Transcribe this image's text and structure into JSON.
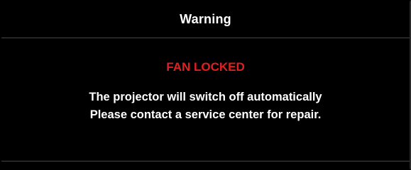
{
  "dialog": {
    "title": "Warning",
    "headline": "FAN LOCKED",
    "message_lines": [
      "The projector will switch off automatically",
      "Please contact a service center for repair."
    ]
  },
  "colors": {
    "background": "#000000",
    "text": "#ffffff",
    "alert": "#e02020",
    "divider": "#b01818"
  }
}
